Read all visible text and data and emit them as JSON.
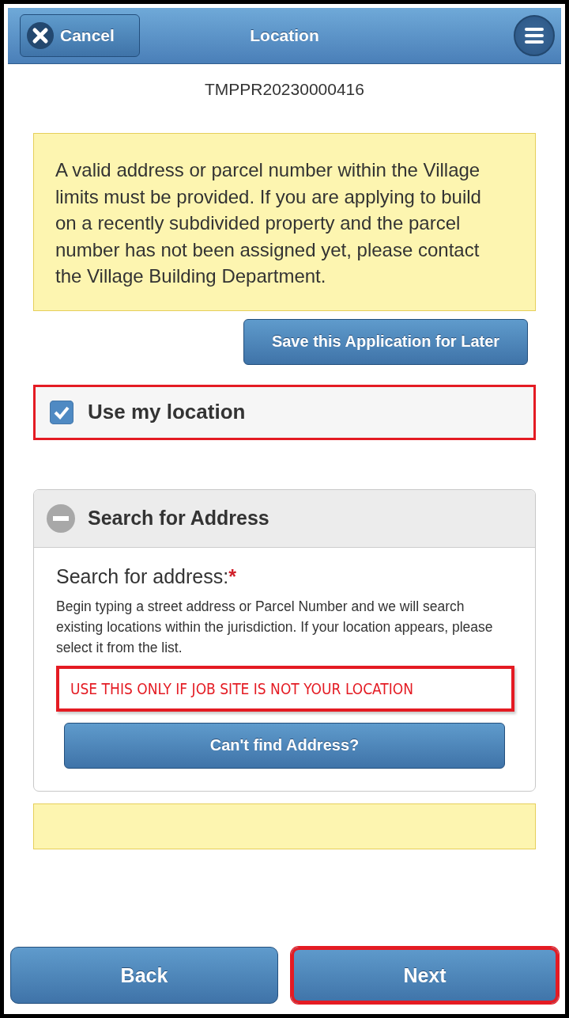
{
  "header": {
    "cancel": "Cancel",
    "title": "Location"
  },
  "record_number": "TMPPR20230000416",
  "notice": "A valid address or parcel number within the Village limits must be provided. If you are applying to build on a recently subdivided property and the parcel number has not been assigned yet, please contact the Village Building Department.",
  "save_button": "Save this Application for Later",
  "use_location": {
    "label": "Use my location",
    "checked": true,
    "highlighted": true
  },
  "search_section": {
    "title": "Search for Address",
    "expanded": true,
    "field_label": "Search for address:",
    "required_mark": "*",
    "help": "Begin typing a street address or Parcel Number and we will search existing locations within the jurisdiction. If your location appears, please select it from the list.",
    "field_value": "USE THIS ONLY IF JOB SITE IS NOT YOUR LOCATION",
    "field_highlighted": true,
    "cant_find": "Can't find Address?"
  },
  "footer_buttons": [
    {
      "label": "Back",
      "highlighted": false
    },
    {
      "label": "Next",
      "highlighted": true
    }
  ]
}
